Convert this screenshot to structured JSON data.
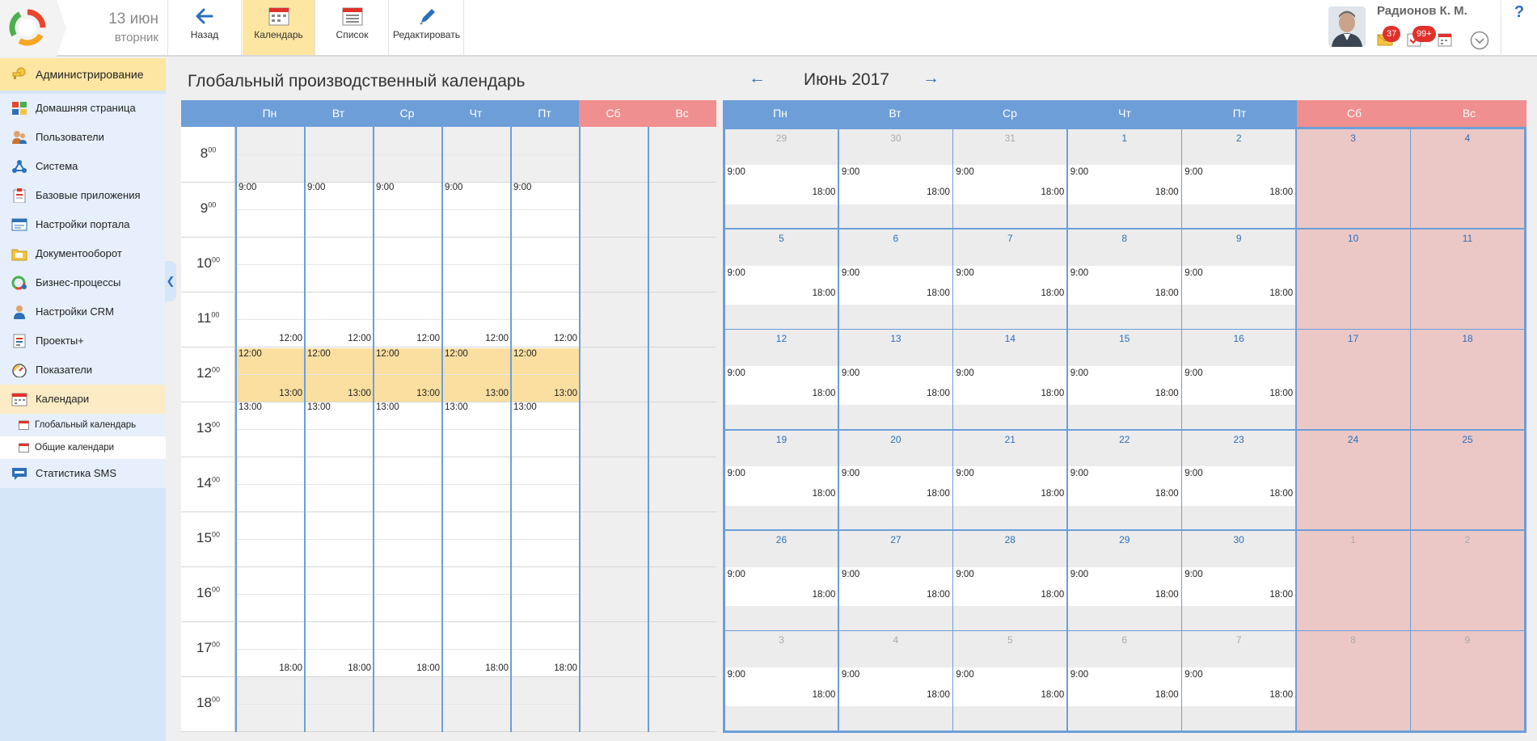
{
  "header": {
    "date_main": "13 июн",
    "date_sub": "вторник",
    "buttons": [
      {
        "label": "Назад",
        "icon": "arrow-left-icon"
      },
      {
        "label": "Календарь",
        "icon": "calendar-icon",
        "active": true
      },
      {
        "label": "Список",
        "icon": "list-icon"
      },
      {
        "label": "Редактировать",
        "icon": "pencil-icon"
      }
    ],
    "user_name": "Радионов К. М.",
    "badges": {
      "messages": "37",
      "tasks": "99+"
    },
    "help": "?"
  },
  "sidebar": {
    "items": [
      {
        "label": "Администрирование",
        "icon": "key-icon"
      },
      {
        "label": "Домашняя страница",
        "icon": "windows-icon"
      },
      {
        "label": "Пользователи",
        "icon": "users-icon"
      },
      {
        "label": "Система",
        "icon": "network-icon"
      },
      {
        "label": "Базовые приложения",
        "icon": "clipboard-icon"
      },
      {
        "label": "Настройки портала",
        "icon": "settings-window-icon"
      },
      {
        "label": "Документооборот",
        "icon": "folder-icon"
      },
      {
        "label": "Бизнес-процессы",
        "icon": "process-icon"
      },
      {
        "label": "Настройки CRM",
        "icon": "crm-user-icon"
      },
      {
        "label": "Проекты+",
        "icon": "projects-icon"
      },
      {
        "label": "Показатели",
        "icon": "gauge-icon"
      },
      {
        "label": "Календари",
        "icon": "calendar-icon"
      }
    ],
    "subitems": [
      {
        "label": "Глобальный календарь",
        "icon": "calendar-small-icon"
      },
      {
        "label": "Общие календари",
        "icon": "calendar-small-icon"
      }
    ],
    "last_item": {
      "label": "Статистика SMS",
      "icon": "sms-icon"
    }
  },
  "page": {
    "title": "Глобальный производственный календарь",
    "month_label": "Июнь 2017",
    "prev_arrow": "←",
    "next_arrow": "→"
  },
  "week_view": {
    "days": [
      "Пн",
      "Вт",
      "Ср",
      "Чт",
      "Пт",
      "Сб",
      "Вс"
    ],
    "hours": [
      "8",
      "9",
      "10",
      "11",
      "12",
      "13",
      "14",
      "15",
      "16",
      "17",
      "18"
    ],
    "minutes_sup": "00",
    "work_start": "9:00",
    "lunch_start": "12:00",
    "lunch_end": "13:00",
    "work_end": "18:00",
    "workdays_count": 5
  },
  "month_view": {
    "days": [
      "Пн",
      "Вт",
      "Ср",
      "Чт",
      "Пт",
      "Сб",
      "Вс"
    ],
    "weeks": [
      [
        "29",
        "30",
        "31",
        "1",
        "2",
        "3",
        "4"
      ],
      [
        "5",
        "6",
        "7",
        "8",
        "9",
        "10",
        "11"
      ],
      [
        "12",
        "13",
        "14",
        "15",
        "16",
        "17",
        "18"
      ],
      [
        "19",
        "20",
        "21",
        "22",
        "23",
        "24",
        "25"
      ],
      [
        "26",
        "27",
        "28",
        "29",
        "30",
        "1",
        "2"
      ],
      [
        "3",
        "4",
        "5",
        "6",
        "7",
        "8",
        "9"
      ]
    ],
    "out_of_month": [
      [
        true,
        true,
        true,
        false,
        false,
        false,
        false
      ],
      [
        false,
        false,
        false,
        false,
        false,
        false,
        false
      ],
      [
        false,
        false,
        false,
        false,
        false,
        false,
        false
      ],
      [
        false,
        false,
        false,
        false,
        false,
        false,
        false
      ],
      [
        false,
        false,
        false,
        false,
        false,
        true,
        true
      ],
      [
        true,
        true,
        true,
        true,
        true,
        true,
        true
      ]
    ],
    "start": "9:00",
    "end": "18:00"
  },
  "colors": {
    "header_blue": "#6d9ed8",
    "weekend_header": "#ef8f8f",
    "weekend_cell": "#ebc8c6",
    "lunch": "#fbdfa0",
    "active_tab": "#fde6a2",
    "sidebar": "#d6e6f9",
    "sidebar_active": "#fde6a2",
    "sidebar_hover": "#e6effb",
    "badge": "#e0312b",
    "link": "#2d6fb9"
  }
}
